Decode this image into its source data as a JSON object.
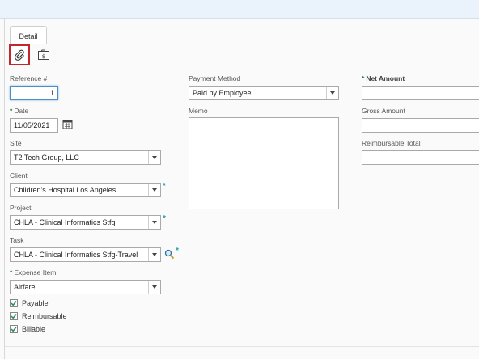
{
  "tabs": [
    {
      "label": "Detail"
    }
  ],
  "toolbar": {
    "attach_icon": "paperclip-icon",
    "expense_icon": "money-folder-icon",
    "accent": "#c0282d"
  },
  "form": {
    "reference_label": "Reference #",
    "reference_value": "1",
    "date_label": "Date",
    "date_value": "11/05/2021",
    "site_label": "Site",
    "site_value": "T2 Tech Group, LLC",
    "client_label": "Client",
    "client_value": "Children's Hospital Los Angeles",
    "project_label": "Project",
    "project_value": "CHLA - Clinical Informatics Stfg",
    "task_label": "Task",
    "task_value": "CHLA - Clinical Informatics Stfg-Travel",
    "expense_item_label": "Expense Item",
    "expense_item_value": "Airfare",
    "payment_method_label": "Payment Method",
    "payment_method_value": "Paid by Employee",
    "memo_label": "Memo",
    "memo_value": "",
    "net_amount_label": "Net Amount",
    "net_amount_value": "",
    "gross_amount_label": "Gross Amount",
    "gross_amount_value": "",
    "reimbursable_total_label": "Reimbursable Total",
    "reimbursable_total_value": "",
    "required_marker": "*",
    "checkboxes": [
      {
        "label": "Payable",
        "checked": true
      },
      {
        "label": "Reimbursable",
        "checked": true
      },
      {
        "label": "Billable",
        "checked": true
      }
    ]
  }
}
